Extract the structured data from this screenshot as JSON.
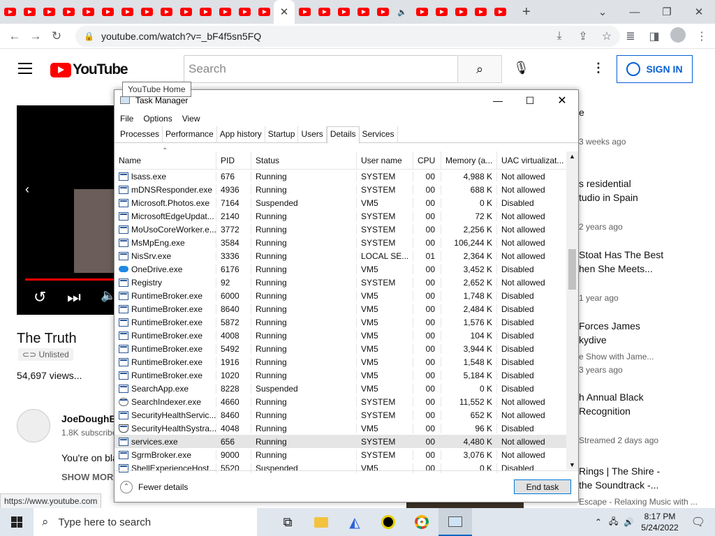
{
  "browser": {
    "url": "youtube.com/watch?v=_bF4f5sn5FQ",
    "tab_count": 26
  },
  "youtube": {
    "search_placeholder": "Search",
    "logo_text": "YouTube",
    "sign_in": "SIGN IN",
    "tooltip": "YouTube Home",
    "video_title": "The Truth",
    "unlisted": "Unlisted",
    "views": "54,697 views...",
    "channel_name": "JoeDoughBo",
    "subscribers": "1.8K subscribe",
    "description": "You're on bla",
    "show_more": "SHOW MORE",
    "status_url": "https://www.youtube.com",
    "sidebar": [
      {
        "title": "e",
        "meta": "3 weeks ago"
      },
      {
        "title": "s residential\ntudio in Spain",
        "meta": "2 years ago"
      },
      {
        "title": "Stoat Has The Best\nhen She Meets...",
        "meta": "1 year ago"
      },
      {
        "title": "Forces James\nkydive",
        "meta": "e Show with Jame...\n3 years ago"
      },
      {
        "title": "h Annual Black\nRecognition",
        "meta": "Streamed 2 days ago"
      },
      {
        "title": "Rings | The Shire -\nthe Soundtrack -...",
        "meta": "Escape - Relaxing Music with ..."
      }
    ]
  },
  "taskmgr": {
    "title": "Task Manager",
    "menu": [
      "File",
      "Options",
      "View"
    ],
    "tabs": [
      "Processes",
      "Performance",
      "App history",
      "Startup",
      "Users",
      "Details",
      "Services"
    ],
    "selected_tab": "Details",
    "columns": [
      "Name",
      "PID",
      "Status",
      "User name",
      "CPU",
      "Memory (a...",
      "UAC virtualizat..."
    ],
    "rows": [
      [
        "lsass.exe",
        "676",
        "Running",
        "SYSTEM",
        "00",
        "4,988 K",
        "Not allowed",
        "app"
      ],
      [
        "mDNSResponder.exe",
        "4936",
        "Running",
        "SYSTEM",
        "00",
        "688 K",
        "Not allowed",
        "app"
      ],
      [
        "Microsoft.Photos.exe",
        "7164",
        "Suspended",
        "VM5",
        "00",
        "0 K",
        "Disabled",
        "app"
      ],
      [
        "MicrosoftEdgeUpdat...",
        "2140",
        "Running",
        "SYSTEM",
        "00",
        "72 K",
        "Not allowed",
        "app"
      ],
      [
        "MoUsoCoreWorker.e...",
        "3772",
        "Running",
        "SYSTEM",
        "00",
        "2,256 K",
        "Not allowed",
        "app"
      ],
      [
        "MsMpEng.exe",
        "3584",
        "Running",
        "SYSTEM",
        "00",
        "106,244 K",
        "Not allowed",
        "app"
      ],
      [
        "NisSrv.exe",
        "3336",
        "Running",
        "LOCAL SE...",
        "01",
        "2,364 K",
        "Not allowed",
        "app"
      ],
      [
        "OneDrive.exe",
        "6176",
        "Running",
        "VM5",
        "00",
        "3,452 K",
        "Disabled",
        "cloud"
      ],
      [
        "Registry",
        "92",
        "Running",
        "SYSTEM",
        "00",
        "2,652 K",
        "Not allowed",
        "app"
      ],
      [
        "RuntimeBroker.exe",
        "6000",
        "Running",
        "VM5",
        "00",
        "1,748 K",
        "Disabled",
        "app"
      ],
      [
        "RuntimeBroker.exe",
        "8640",
        "Running",
        "VM5",
        "00",
        "2,484 K",
        "Disabled",
        "app"
      ],
      [
        "RuntimeBroker.exe",
        "5872",
        "Running",
        "VM5",
        "00",
        "1,576 K",
        "Disabled",
        "app"
      ],
      [
        "RuntimeBroker.exe",
        "4008",
        "Running",
        "VM5",
        "00",
        "104 K",
        "Disabled",
        "app"
      ],
      [
        "RuntimeBroker.exe",
        "5492",
        "Running",
        "VM5",
        "00",
        "3,944 K",
        "Disabled",
        "app"
      ],
      [
        "RuntimeBroker.exe",
        "1916",
        "Running",
        "VM5",
        "00",
        "1,548 K",
        "Disabled",
        "app"
      ],
      [
        "RuntimeBroker.exe",
        "1020",
        "Running",
        "VM5",
        "00",
        "5,184 K",
        "Disabled",
        "app"
      ],
      [
        "SearchApp.exe",
        "8228",
        "Suspended",
        "VM5",
        "00",
        "0 K",
        "Disabled",
        "app"
      ],
      [
        "SearchIndexer.exe",
        "4660",
        "Running",
        "SYSTEM",
        "00",
        "11,552 K",
        "Not allowed",
        "person"
      ],
      [
        "SecurityHealthServic...",
        "8460",
        "Running",
        "SYSTEM",
        "00",
        "652 K",
        "Not allowed",
        "app"
      ],
      [
        "SecurityHealthSystra...",
        "4048",
        "Running",
        "VM5",
        "00",
        "96 K",
        "Disabled",
        "shield"
      ],
      [
        "services.exe",
        "656",
        "Running",
        "SYSTEM",
        "00",
        "4,480 K",
        "Not allowed",
        "app"
      ],
      [
        "SgrmBroker.exe",
        "9000",
        "Running",
        "SYSTEM",
        "00",
        "3,076 K",
        "Not allowed",
        "app"
      ],
      [
        "ShellExperienceHost...",
        "5520",
        "Suspended",
        "VM5",
        "00",
        "0 K",
        "Disabled",
        "app"
      ]
    ],
    "selected_row": 20,
    "fewer_details": "Fewer details",
    "end_task": "End task"
  },
  "taskbar": {
    "search_placeholder": "Type here to search",
    "time": "8:17 PM",
    "date": "5/24/2022"
  }
}
